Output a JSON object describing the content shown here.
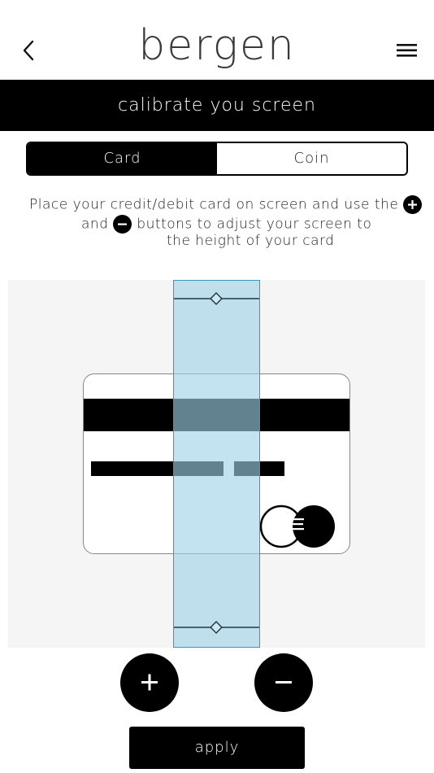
{
  "header": {
    "back_icon": "chevron-left-icon",
    "logo": "bergen",
    "menu_icon": "hamburger-menu-icon"
  },
  "title_bar": {
    "title": "calibrate you screen"
  },
  "tabs": [
    {
      "label": "Card",
      "active": true
    },
    {
      "label": "Coin",
      "active": false
    }
  ],
  "instructions": {
    "part1": "Place your credit/debit card on screen and use the",
    "part2": "and",
    "part3": "buttons to adjust your screen to",
    "part4": "the height of your card",
    "plus_icon": "plus-circle-icon",
    "minus_icon": "minus-circle-icon"
  },
  "calibration": {
    "card_icon": "credit-card-icon",
    "band_color": "#a0d2e8",
    "band_border_color": "#3c95bd"
  },
  "controls": {
    "increase_icon": "plus-icon",
    "decrease_icon": "minus-icon",
    "apply_label": "apply"
  }
}
